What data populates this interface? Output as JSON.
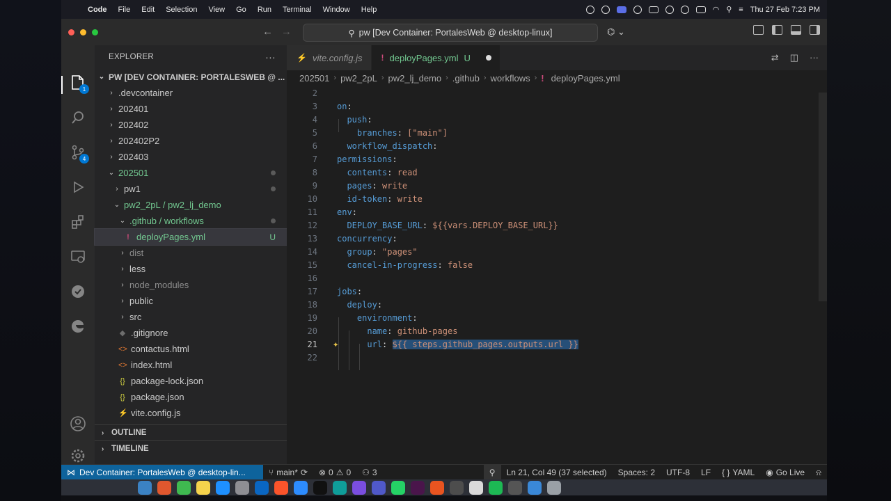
{
  "menubar": {
    "app_name": "Code",
    "items": [
      "File",
      "Edit",
      "Selection",
      "View",
      "Go",
      "Run",
      "Terminal",
      "Window",
      "Help"
    ],
    "datetime": "Thu 27 Feb 7:23 PM"
  },
  "titlebar": {
    "command_center": "pw [Dev Container: PortalesWeb @ desktop-linux]"
  },
  "activity": {
    "explorer_badge": "1",
    "scm_badge": "4"
  },
  "sidebar": {
    "title": "EXPLORER",
    "more": "···",
    "tree": [
      {
        "label": "PW [DEV CONTAINER: PORTALESWEB @ ...",
        "chev": "⌄",
        "type": "root"
      },
      {
        "label": ".devcontainer",
        "chev": "›"
      },
      {
        "label": "202401",
        "chev": "›"
      },
      {
        "label": "202402",
        "chev": "›"
      },
      {
        "label": "202402P2",
        "chev": "›"
      },
      {
        "label": "202403",
        "chev": "›"
      },
      {
        "label": "202501",
        "chev": "⌄"
      },
      {
        "label": "pw1",
        "chev": "›"
      },
      {
        "label": "pw2_2pL / pw2_lj_demo",
        "chev": "⌄"
      },
      {
        "label": ".github / workflows",
        "chev": "⌄"
      },
      {
        "label": "deployPages.yml",
        "icon": "!",
        "status": "U"
      },
      {
        "label": "dist",
        "chev": "›"
      },
      {
        "label": "less",
        "chev": "›"
      },
      {
        "label": "node_modules",
        "chev": "›"
      },
      {
        "label": "public",
        "chev": "›"
      },
      {
        "label": "src",
        "chev": "›"
      },
      {
        "label": ".gitignore",
        "icon": "◆"
      },
      {
        "label": "contactus.html",
        "icon": "<>"
      },
      {
        "label": "index.html",
        "icon": "<>"
      },
      {
        "label": "package-lock.json",
        "icon": "{}"
      },
      {
        "label": "package.json",
        "icon": "{}"
      },
      {
        "label": "vite.config.js",
        "icon": "⚡"
      }
    ],
    "sections": {
      "outline": "OUTLINE",
      "timeline": "TIMELINE"
    }
  },
  "tabs": [
    {
      "label": "vite.config.js",
      "icon": "⚡"
    },
    {
      "label": "deployPages.yml",
      "icon": "!",
      "status": "U"
    }
  ],
  "breadcrumb": [
    "202501",
    "pw2_2pL",
    "pw2_lj_demo",
    ".github",
    "workflows",
    "deployPages.yml"
  ],
  "code": {
    "lines": [
      {
        "n": "2",
        "text": ""
      },
      {
        "n": "3",
        "text": "on:"
      },
      {
        "n": "4",
        "text": "  push:"
      },
      {
        "n": "5",
        "text": "    branches: [\"main\"]"
      },
      {
        "n": "6",
        "text": "  workflow_dispatch:"
      },
      {
        "n": "7",
        "text": "permissions:"
      },
      {
        "n": "8",
        "text": "  contents: read"
      },
      {
        "n": "9",
        "text": "  pages: write"
      },
      {
        "n": "10",
        "text": "  id-token: write"
      },
      {
        "n": "11",
        "text": "env:"
      },
      {
        "n": "12",
        "text": "  DEPLOY_BASE_URL: ${{vars.DEPLOY_BASE_URL}}"
      },
      {
        "n": "13",
        "text": "concurrency:"
      },
      {
        "n": "14",
        "text": "  group: \"pages\""
      },
      {
        "n": "15",
        "text": "  cancel-in-progress: false"
      },
      {
        "n": "16",
        "text": ""
      },
      {
        "n": "17",
        "text": "jobs:"
      },
      {
        "n": "18",
        "text": "  deploy:"
      },
      {
        "n": "19",
        "text": "    environment:"
      },
      {
        "n": "20",
        "text": "      name: github-pages"
      },
      {
        "n": "21",
        "text": "      url: ${{ steps.github_pages.outputs.url }}"
      },
      {
        "n": "22",
        "text": ""
      }
    ],
    "current_line": "21"
  },
  "statusbar": {
    "remote": "Dev Container: PortalesWeb @ desktop-lin...",
    "branch": "main*",
    "errors": "0",
    "warnings": "0",
    "ports": "3",
    "position": "Ln 21, Col 49 (37 selected)",
    "spaces": "Spaces: 2",
    "encoding": "UTF-8",
    "eol": "LF",
    "language": "YAML",
    "golive": "Go Live"
  },
  "colors": {
    "accent": "#0078d4",
    "remote_bg": "#0e639c",
    "git_untracked": "#73c991",
    "selection": "#264f78"
  }
}
